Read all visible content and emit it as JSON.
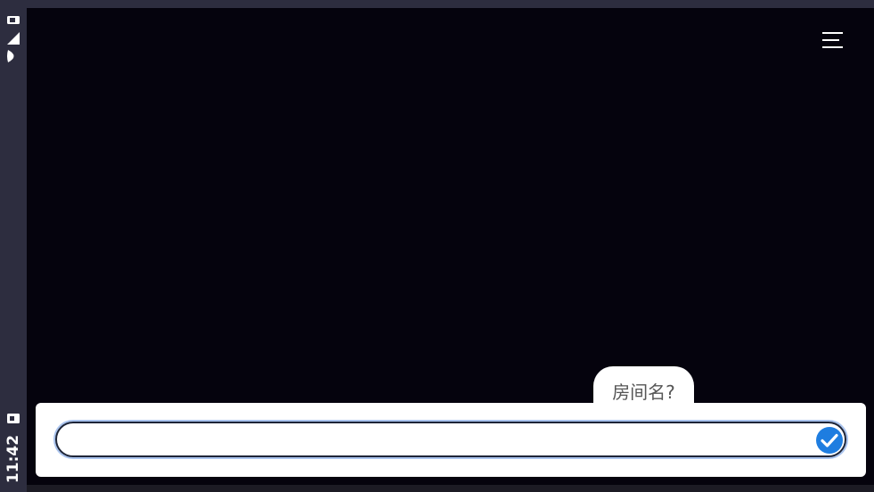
{
  "status_bar": {
    "time": "11:42",
    "icons": [
      "notification-icon",
      "signal-icon",
      "wifi-icon",
      "screenshot-icon"
    ]
  },
  "header": {
    "menu_icon": "menu-icon"
  },
  "chat": {
    "prompt_bubble": "房间名?"
  },
  "input": {
    "value": "",
    "placeholder": "",
    "confirm_icon": "check-circle-icon"
  },
  "colors": {
    "background": "#05030d",
    "status_bar": "#2d2d3f",
    "accent": "#1e7de0"
  }
}
